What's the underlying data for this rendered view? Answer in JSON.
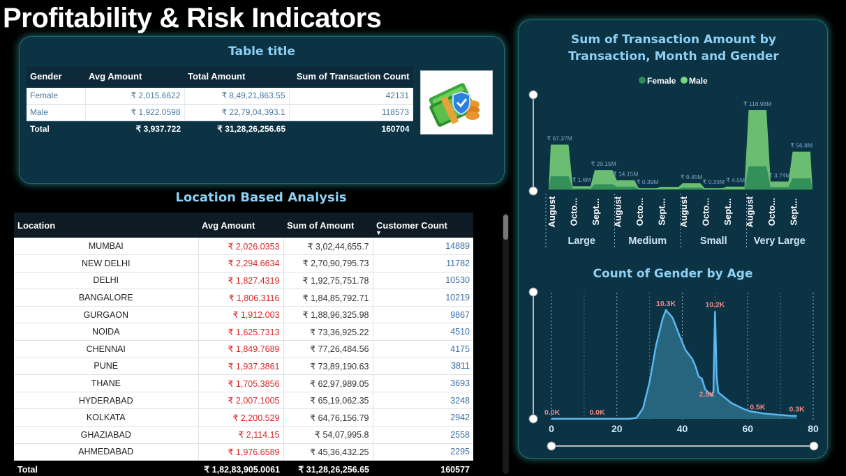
{
  "page": {
    "title": "Profitability & Risk Indicators"
  },
  "gender_table": {
    "title": "Table title",
    "headers": [
      "Gender",
      "Avg Amount",
      "Total Amount",
      "Sum of Transaction Count"
    ],
    "rows": [
      [
        "Female",
        "₹ 2,015.6622",
        "₹ 8,49,21,863.55",
        "42131"
      ],
      [
        "Male",
        "₹ 1,922.0598",
        "₹ 22,79,04,393.1",
        "118573"
      ]
    ],
    "total": [
      "Total",
      "₹ 3,937.722",
      "₹ 31,28,26,256.65",
      "160704"
    ]
  },
  "location_table": {
    "title": "Location Based Analysis",
    "headers": [
      "Location",
      "Avg Amount",
      "Sum of Amount",
      "Customer Count"
    ],
    "sort_column": "Customer Count",
    "rows": [
      [
        "MUMBAI",
        "₹ 2,026.0353",
        "₹ 3,02,44,655.7",
        "14889"
      ],
      [
        "NEW DELHI",
        "₹ 2,294.6634",
        "₹ 2,70,90,795.73",
        "11782"
      ],
      [
        "DELHI",
        "₹ 1,827.4319",
        "₹ 1,92,75,751.78",
        "10530"
      ],
      [
        "BANGALORE",
        "₹ 1,806.3116",
        "₹ 1,84,85,792.71",
        "10219"
      ],
      [
        "GURGAON",
        "₹ 1,912.003",
        "₹ 1,88,96,325.98",
        "9867"
      ],
      [
        "NOIDA",
        "₹ 1,625.7313",
        "₹ 73,36,925.22",
        "4510"
      ],
      [
        "CHENNAI",
        "₹ 1,849.7689",
        "₹ 77,26,484.56",
        "4175"
      ],
      [
        "PUNE",
        "₹ 1,937.3861",
        "₹ 73,89,190.63",
        "3811"
      ],
      [
        "THANE",
        "₹ 1,705.3856",
        "₹ 62,97,989.05",
        "3693"
      ],
      [
        "HYDERABAD",
        "₹ 2,007.1005",
        "₹ 65,19,062.35",
        "3248"
      ],
      [
        "KOLKATA",
        "₹ 2,200.529",
        "₹ 64,76,156.79",
        "2942"
      ],
      [
        "GHAZIABAD",
        "₹ 2,114.15",
        "₹ 54,07,995.8",
        "2558"
      ],
      [
        "AHMEDABAD",
        "₹ 1,976.6589",
        "₹ 45,36,432.25",
        "2295"
      ]
    ],
    "total": [
      "Total",
      "₹ 1,82,83,905.0061",
      "₹ 31,28,26,256.65",
      "160577"
    ]
  },
  "colors": {
    "female": "#2e8b57",
    "male": "#7cd67a",
    "area": "#2a6a86",
    "line": "#5ab8f0",
    "accent": "#8fd0f5",
    "label": "#f08a8a"
  },
  "chart_data": [
    {
      "type": "area",
      "title": "Sum of Transaction Amount by Transaction, Month and Gender",
      "legend": {
        "position": "top-center",
        "entries": [
          "Female",
          "Male"
        ]
      },
      "groups": [
        "Large",
        "Medium",
        "Small",
        "Very Large"
      ],
      "months": [
        "August",
        "Octo...",
        "Sept..."
      ],
      "series": [
        {
          "name": "Female",
          "values": [
            20,
            1.6,
            8,
            4.5,
            0.39,
            0.8,
            3,
            0.33,
            0.5,
            35,
            3.74,
            17
          ]
        },
        {
          "name": "Male",
          "values": [
            67.37,
            5,
            29.15,
            14.15,
            2,
            4,
            9.45,
            2,
            4.5,
            118.98,
            12,
            56.8
          ]
        }
      ],
      "data_labels": [
        "₹ 67.37M",
        "₹ 1.6M",
        "₹ 29.15M",
        "₹ 14.15M",
        "₹ 0.39M",
        "",
        "₹ 9.45M",
        "₹ 0.33M",
        "₹ 4.5M",
        "₹ 118.98M",
        "₹ 3.74M",
        "₹ 56.8M"
      ]
    },
    {
      "type": "area",
      "title": "Count of Gender by Age",
      "xlim": [
        0,
        80
      ],
      "xticks": [
        "0",
        "20",
        "40",
        "60",
        "80"
      ],
      "points": [
        [
          0,
          0
        ],
        [
          5,
          0
        ],
        [
          10,
          0
        ],
        [
          15,
          0
        ],
        [
          20,
          0
        ],
        [
          24,
          5
        ],
        [
          26,
          100
        ],
        [
          28,
          1000
        ],
        [
          30,
          3500
        ],
        [
          32,
          7000
        ],
        [
          34,
          9500
        ],
        [
          35,
          10300
        ],
        [
          37,
          9600
        ],
        [
          39,
          8000
        ],
        [
          41,
          6500
        ],
        [
          43,
          5700
        ],
        [
          44,
          5000
        ],
        [
          45,
          4000
        ],
        [
          46,
          3800
        ],
        [
          47,
          2800
        ],
        [
          48,
          2500
        ],
        [
          49,
          2200
        ],
        [
          49.5,
          2600
        ],
        [
          50,
          10200
        ],
        [
          50.5,
          4000
        ],
        [
          51,
          2500
        ],
        [
          53,
          2000
        ],
        [
          55,
          1500
        ],
        [
          57,
          1200
        ],
        [
          59,
          900
        ],
        [
          61,
          700
        ],
        [
          63,
          600
        ],
        [
          65,
          500
        ],
        [
          67,
          450
        ],
        [
          69,
          400
        ],
        [
          71,
          350
        ],
        [
          73,
          300
        ],
        [
          75,
          280
        ]
      ],
      "data_labels": [
        {
          "x": 0,
          "y": 0,
          "label": "0.0K"
        },
        {
          "x": 14,
          "y": 0,
          "label": "0.0K"
        },
        {
          "x": 35,
          "y": 10300,
          "label": "10.3K"
        },
        {
          "x": 50,
          "y": 10200,
          "label": "10.2K"
        },
        {
          "x": 49,
          "y": 2500,
          "label": "2.5K"
        },
        {
          "x": 63,
          "y": 500,
          "label": "0.5K"
        },
        {
          "x": 75,
          "y": 300,
          "label": "0.3K"
        }
      ]
    }
  ]
}
